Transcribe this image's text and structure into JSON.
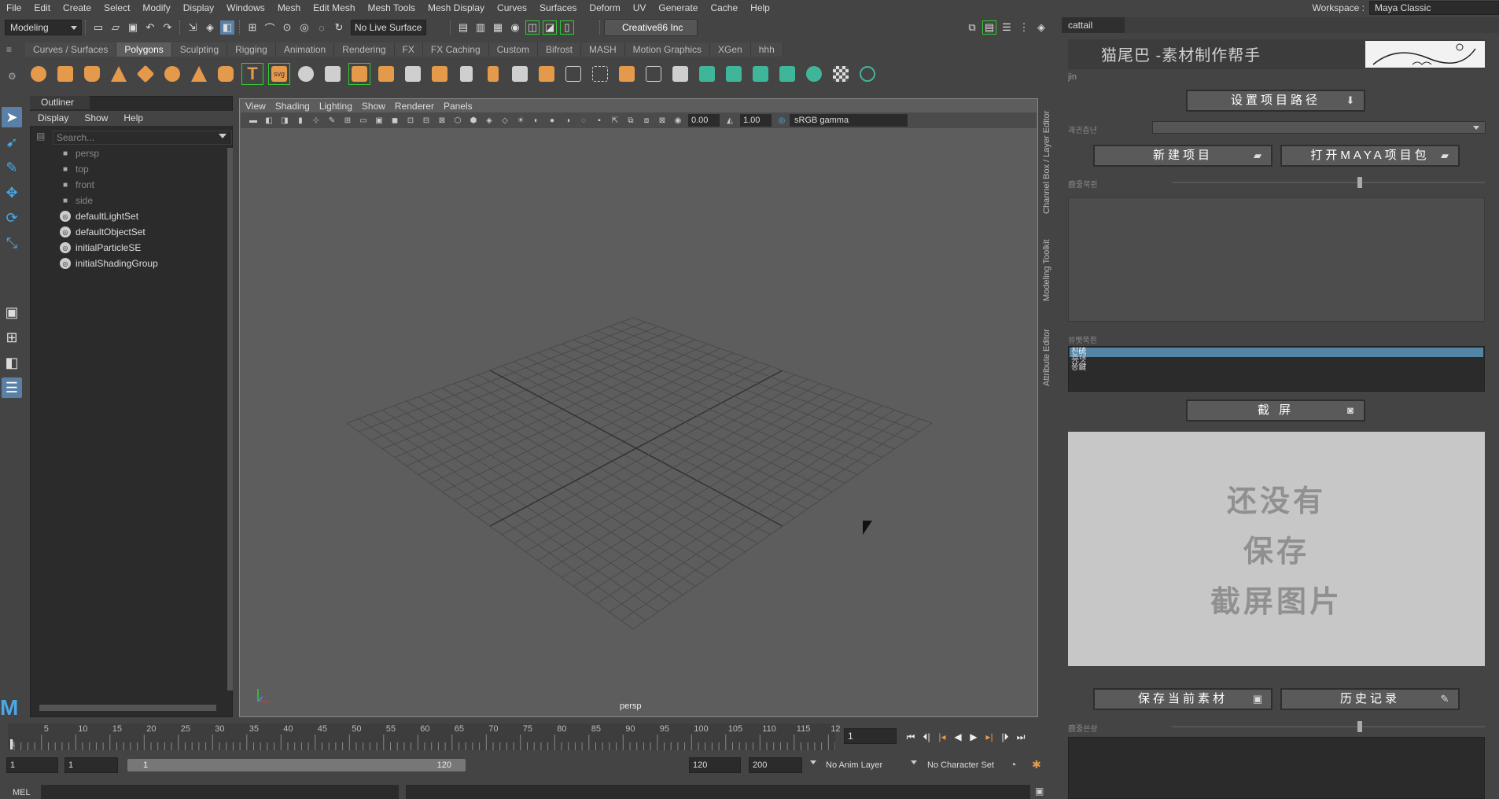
{
  "menubar": {
    "items": [
      "File",
      "Edit",
      "Create",
      "Select",
      "Modify",
      "Display",
      "Windows",
      "Mesh",
      "Edit Mesh",
      "Mesh Tools",
      "Mesh Display",
      "Curves",
      "Surfaces",
      "Deform",
      "UV",
      "Generate",
      "Cache",
      "Help"
    ],
    "workspace_label": "Workspace :",
    "workspace_value": "Maya Classic"
  },
  "statusline": {
    "mode": "Modeling",
    "live_surface": "No Live Surface",
    "user": "Creative86 Inc"
  },
  "shelf": {
    "tabs": [
      "Curves / Surfaces",
      "Polygons",
      "Sculpting",
      "Rigging",
      "Animation",
      "Rendering",
      "FX",
      "FX Caching",
      "Custom",
      "Bifrost",
      "MASH",
      "Motion Graphics",
      "XGen",
      "hhh"
    ],
    "active_tab": "Polygons"
  },
  "outliner": {
    "tab": "Outliner",
    "menu": [
      "Display",
      "Show",
      "Help"
    ],
    "search_placeholder": "Search...",
    "cameras": [
      "persp",
      "top",
      "front",
      "side"
    ],
    "sets": [
      "defaultLightSet",
      "defaultObjectSet",
      "initialParticleSE",
      "initialShadingGroup"
    ]
  },
  "viewport": {
    "menu": [
      "View",
      "Shading",
      "Lighting",
      "Show",
      "Renderer",
      "Panels"
    ],
    "exposure": "0.00",
    "gamma": "1.00",
    "color_space": "sRGB gamma",
    "camera_label": "persp"
  },
  "side_tabs": [
    "Channel Box / Layer Editor",
    "Modeling Toolkit",
    "Attribute Editor"
  ],
  "timeline": {
    "ticks": [
      "5",
      "10",
      "15",
      "20",
      "25",
      "30",
      "35",
      "40",
      "45",
      "50",
      "55",
      "60",
      "65",
      "70",
      "75",
      "80",
      "85",
      "90",
      "95",
      "100",
      "105",
      "110",
      "115",
      "12"
    ],
    "first_tick": "1",
    "current_frame": "1"
  },
  "range": {
    "start": "1",
    "playback_start": "1",
    "slider_start": "1",
    "slider_end": "120",
    "playback_end": "120",
    "end": "200",
    "anim_layer": "No Anim Layer",
    "character_set": "No Character Set"
  },
  "cmdline": {
    "label": "MEL"
  },
  "cattail": {
    "tab": "cattail",
    "title": "猫尾巴 -素材制作帮手",
    "user": "jin",
    "set_path_btn": "设置项目路径",
    "new_project_btn": "新建项目",
    "open_maya_btn": "打开MAYA项目包",
    "label_1": "괘귄츰냔",
    "label_2": "鹿줄쭉쥔",
    "label_3": "쓔뻣쭉쥔",
    "list_items": [
      "친硫",
      "亮뎃",
      "쯩鍵"
    ],
    "screenshot_btn": "截 屏",
    "placeholder_line1": "还没有",
    "placeholder_line2": "保存",
    "placeholder_line3": "截屏图片",
    "save_btn": "保存当前素材",
    "history_btn": "历史记录",
    "label_4": "鹿줄쓴솽"
  }
}
